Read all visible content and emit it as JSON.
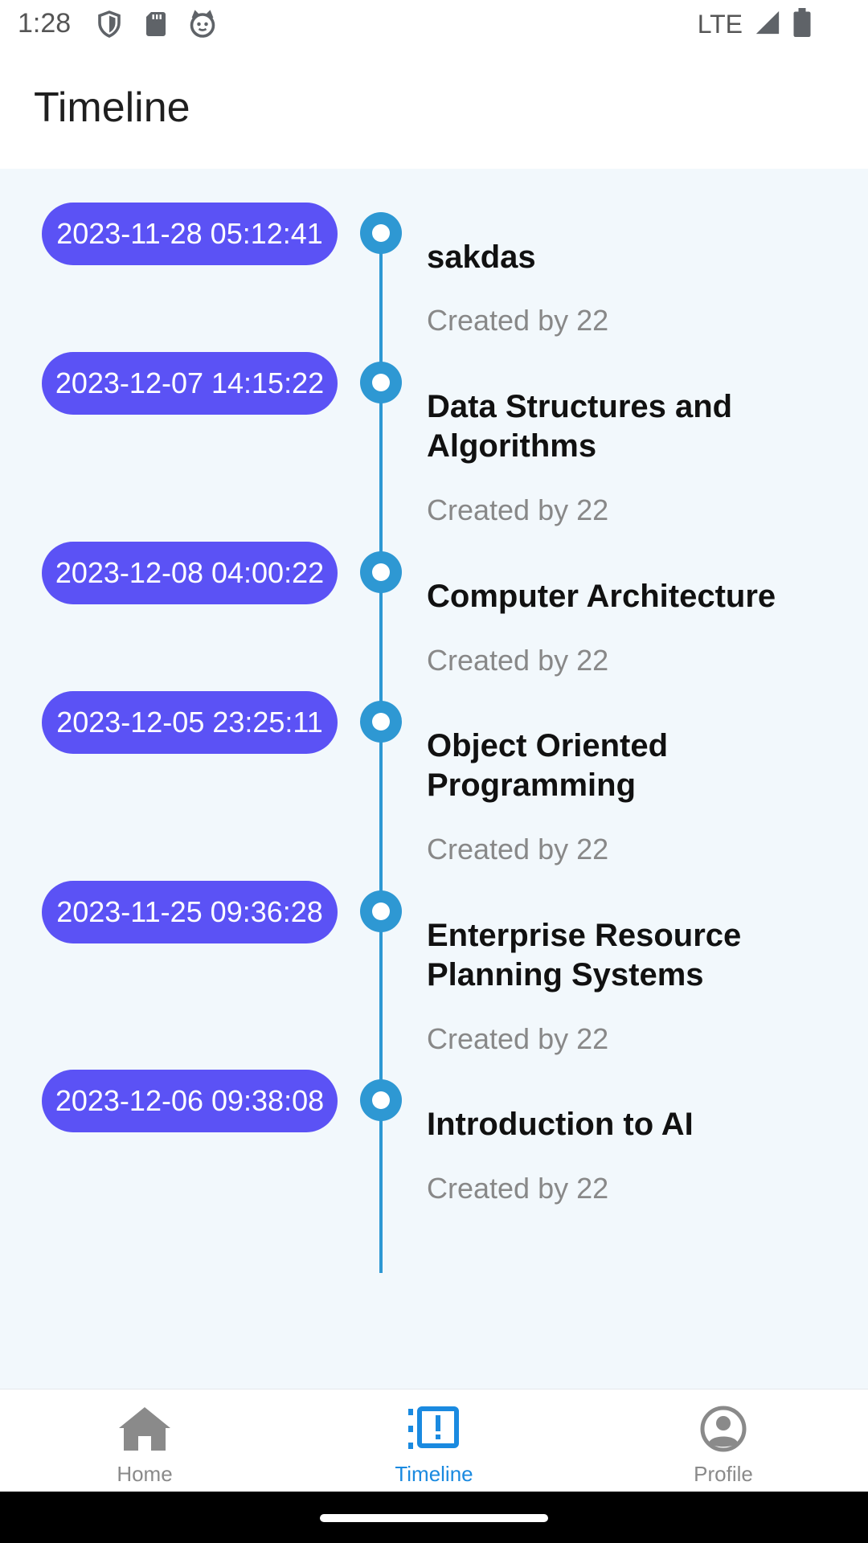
{
  "status_bar": {
    "time": "1:28",
    "network": "LTE",
    "left_icons": [
      "shield-icon",
      "sd-card-icon",
      "cat-face-icon"
    ],
    "right_icons": [
      "signal-icon",
      "battery-icon"
    ]
  },
  "app_bar": {
    "title": "Timeline"
  },
  "timeline": {
    "accent_color": "#2e98d3",
    "pill_color": "#5b52f5",
    "items": [
      {
        "date": "2023-11-28 05:12:41",
        "title": "sakdas",
        "subtitle": "Created by 22"
      },
      {
        "date": "2023-12-07 14:15:22",
        "title": "Data Structures and Algorithms",
        "subtitle": "Created by 22"
      },
      {
        "date": "2023-12-08 04:00:22",
        "title": "Computer Architecture",
        "subtitle": "Created by 22"
      },
      {
        "date": "2023-12-05 23:25:11",
        "title": "Object Oriented Programming",
        "subtitle": "Created by 22"
      },
      {
        "date": "2023-11-25 09:36:28",
        "title": "Enterprise Resource Planning Systems",
        "subtitle": "Created by 22"
      },
      {
        "date": "2023-12-06 09:38:08",
        "title": "Introduction to AI",
        "subtitle": "Created by 22"
      }
    ]
  },
  "bottom_nav": {
    "active_color": "#1a8ae0",
    "items": [
      {
        "label": "Home",
        "icon": "home-icon",
        "active": false
      },
      {
        "label": "Timeline",
        "icon": "timeline-icon",
        "active": true
      },
      {
        "label": "Profile",
        "icon": "profile-icon",
        "active": false
      }
    ]
  }
}
